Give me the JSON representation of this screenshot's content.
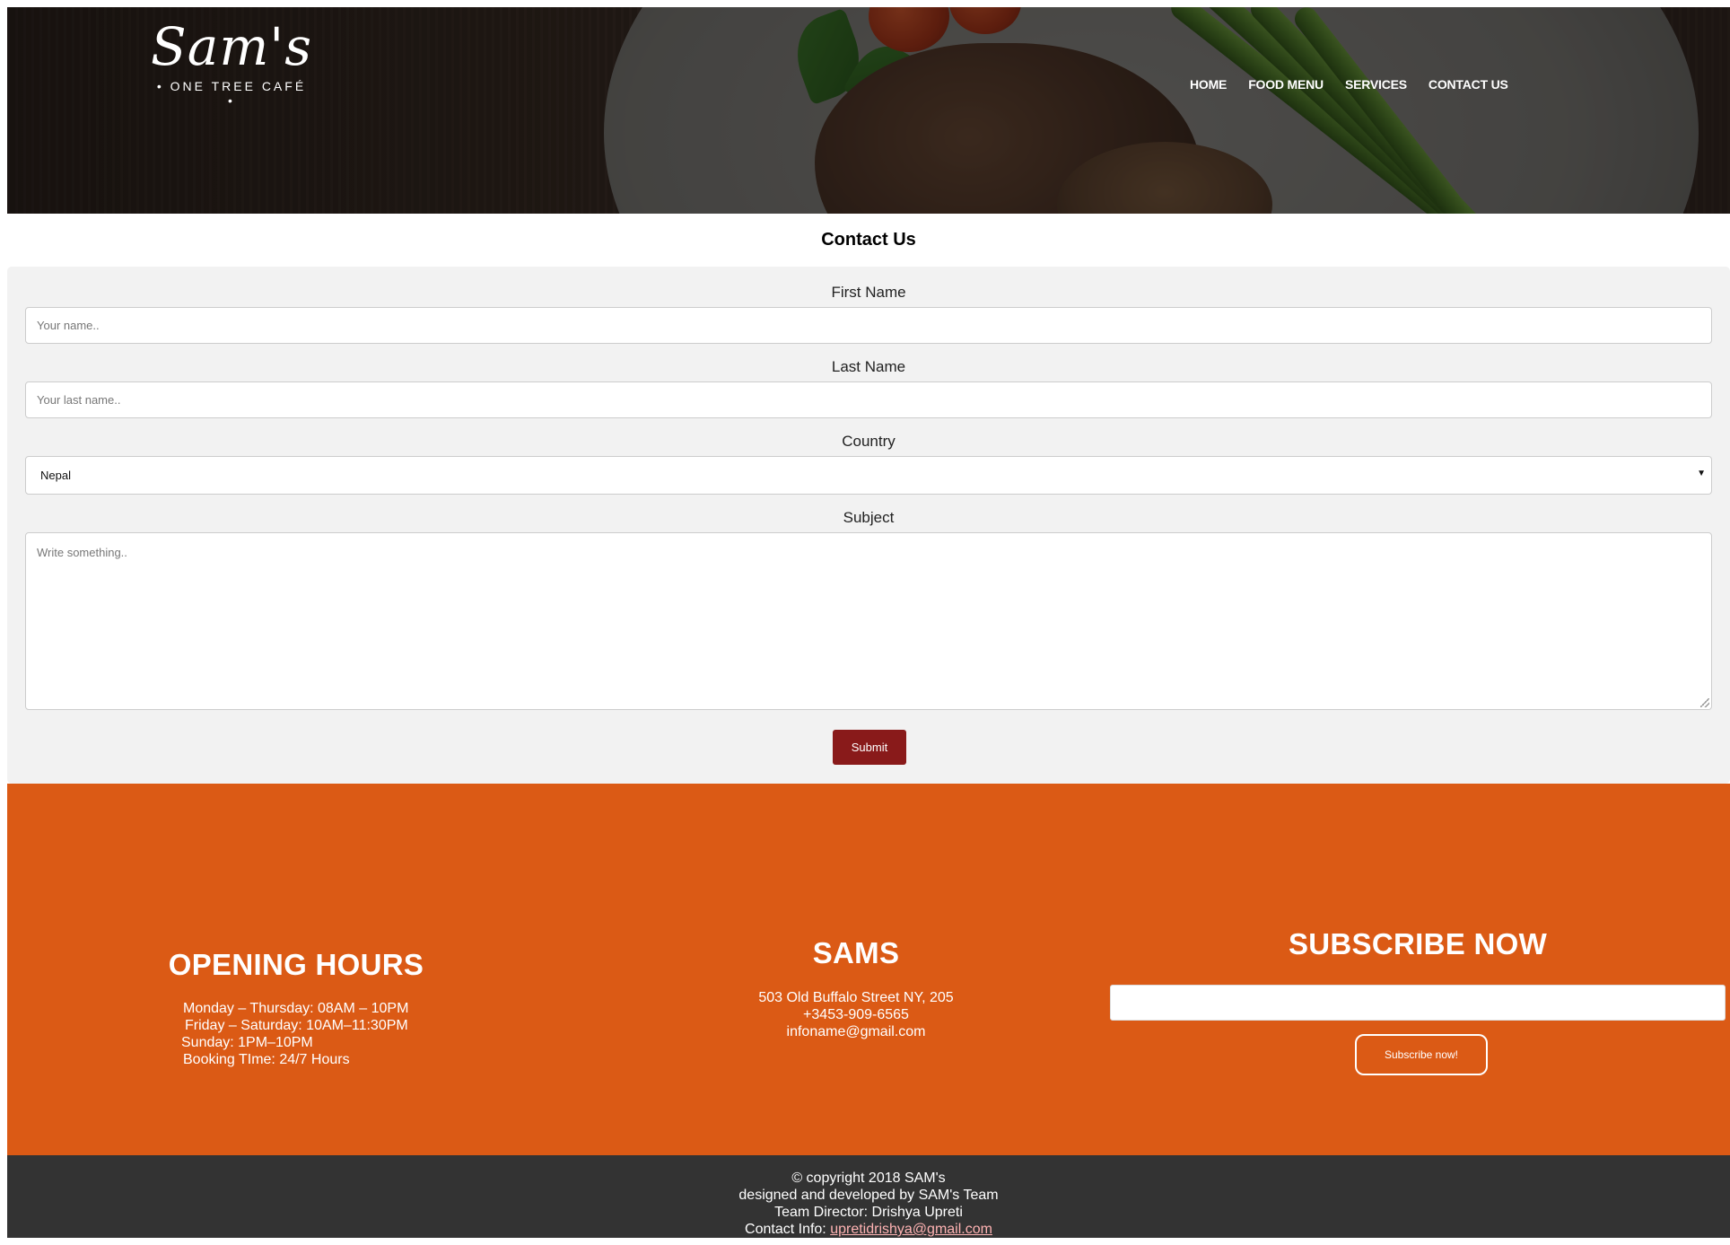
{
  "brand": {
    "logo_script": "Sam's",
    "logo_subtitle": "• ONE TREE CAFÉ •"
  },
  "nav": {
    "items": [
      "HOME",
      "FOOD MENU",
      "SERVICES",
      "CONTACT US"
    ]
  },
  "contact": {
    "title": "Contact Us",
    "first_name_label": "First Name",
    "first_name_placeholder": "Your name..",
    "last_name_label": "Last Name",
    "last_name_placeholder": "Your last name..",
    "country_label": "Country",
    "country_value": "Nepal",
    "subject_label": "Subject",
    "subject_placeholder": "Write something..",
    "submit_label": "Submit"
  },
  "footer": {
    "opening_hours_title": "OPENING HOURS",
    "opening_hours": [
      "Monday – Thursday: 08AM – 10PM",
      "Friday – Saturday: 10AM–11:30PM",
      "Sunday: 1PM–10PM",
      "Booking TIme: 24/7 Hours"
    ],
    "sams_title": "SAMS",
    "address": "503 Old Buffalo Street NY, 205",
    "phone": "+3453-909-6565",
    "email": "infoname@gmail.com",
    "subscribe_title": "SUBSCRIBE NOW",
    "subscribe_button": "Subscribe now!"
  },
  "bottom": {
    "copyright": "© copyright 2018 SAM's",
    "credit": "designed and developed by SAM's Team",
    "director": "Team Director: Drishya Upreti",
    "contact_prefix": "Contact Info: ",
    "contact_email": "upretidrishya@gmail.com"
  },
  "colors": {
    "submit_bg": "#891a1a",
    "footer_orange": "#db5a15",
    "footer_dark": "#333333",
    "form_bg": "#f2f2f2"
  }
}
